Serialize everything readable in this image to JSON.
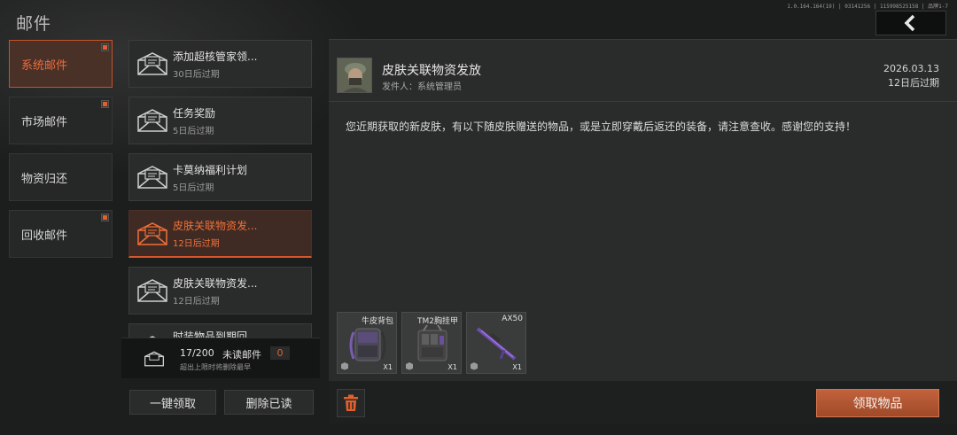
{
  "header": {
    "title": "邮件",
    "version": "1.0.164.164(19) | 03141256 | 115998525158 | 品牌1-7"
  },
  "categories": [
    {
      "label": "系统邮件",
      "active": true,
      "badge": true
    },
    {
      "label": "市场邮件",
      "active": false,
      "badge": true
    },
    {
      "label": "物资归还",
      "active": false,
      "badge": false
    },
    {
      "label": "回收邮件",
      "active": false,
      "badge": true
    }
  ],
  "mails": [
    {
      "title": "添加超核管家领...",
      "expiry": "30日后过期",
      "active": false
    },
    {
      "title": "任务奖励",
      "expiry": "5日后过期",
      "active": false
    },
    {
      "title": "卡莫纳福利计划",
      "expiry": "5日后过期",
      "active": false
    },
    {
      "title": "皮肤关联物资发...",
      "expiry": "12日后过期",
      "active": true
    },
    {
      "title": "皮肤关联物资发...",
      "expiry": "12日后过期",
      "active": false
    },
    {
      "title": "时装物品到期回...",
      "expiry": "",
      "active": false
    }
  ],
  "summary": {
    "count": "17/200",
    "unread_label": "未读邮件",
    "unread_value": "0",
    "hint": "超出上限时将删除最早"
  },
  "buttons": {
    "claim_all": "一键领取",
    "delete_read": "删除已读",
    "claim_items": "领取物品"
  },
  "detail": {
    "title": "皮肤关联物资发放",
    "sender": "发件人：系统管理员",
    "date": "2026.03.13",
    "expiry": "12日后过期",
    "body": "您近期获取的新皮肤，有以下随皮肤赠送的物品，或是立即穿戴后返还的装备，请注意查收。感谢您的支持！",
    "attachments": [
      {
        "name": "牛皮背包",
        "qty": "X1",
        "icon": "backpack-icon"
      },
      {
        "name": "TM2胸挂甲",
        "qty": "X1",
        "icon": "chest-rig-icon"
      },
      {
        "name": "AX50",
        "qty": "X1",
        "icon": "sniper-rifle-icon"
      }
    ]
  },
  "colors": {
    "accent": "#e1602c",
    "claim_button": "#b4552f",
    "background": "#1c1d1d"
  }
}
